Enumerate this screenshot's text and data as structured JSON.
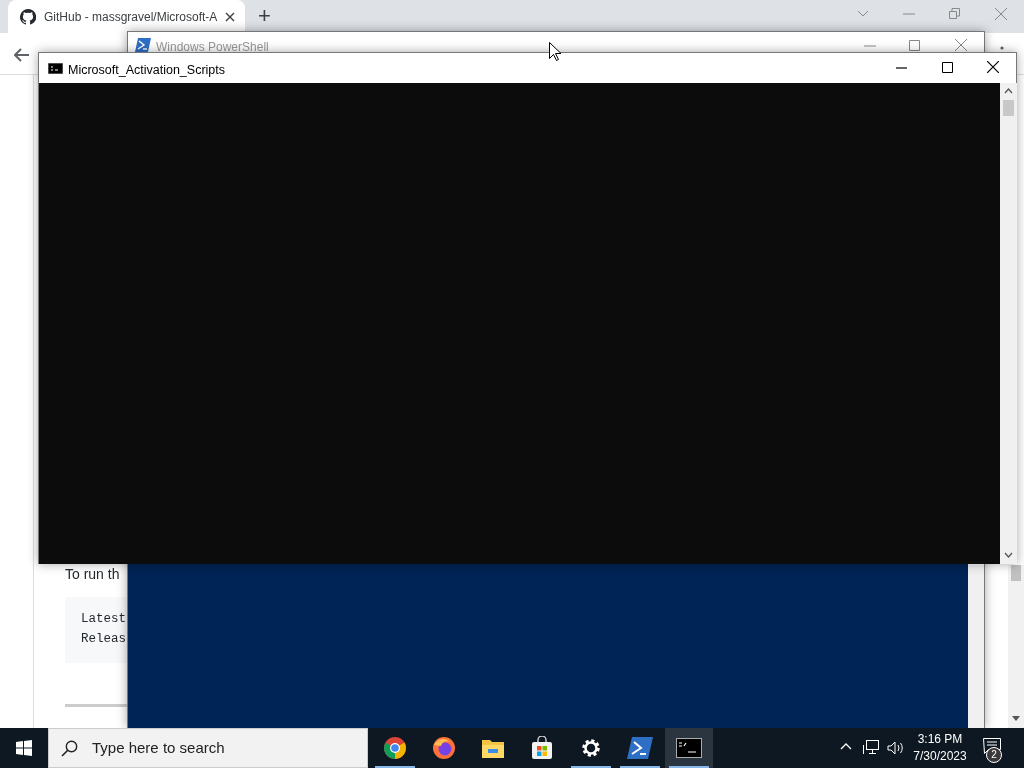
{
  "browser": {
    "tab": {
      "title": "GitHub - massgravel/Microsoft-A",
      "selected": true
    },
    "new_tab": "+",
    "page": {
      "intro": "To run th",
      "code_lines": [
        "Latest",
        "Releas"
      ]
    }
  },
  "powershell": {
    "title": "Windows PowerShell"
  },
  "console": {
    "title": "Microsoft_Activation_Scripts"
  },
  "taskbar": {
    "search": {
      "placeholder": "Type here to search"
    },
    "apps": [
      {
        "kind": "chrome",
        "running": true,
        "selected": false
      },
      {
        "kind": "firefox",
        "running": false,
        "selected": false
      },
      {
        "kind": "explorer",
        "running": false,
        "selected": false
      },
      {
        "kind": "store",
        "running": false,
        "selected": false
      },
      {
        "kind": "settings",
        "running": true,
        "selected": false
      },
      {
        "kind": "powershell",
        "running": true,
        "selected": false
      },
      {
        "kind": "console",
        "running": true,
        "selected": true
      }
    ],
    "clock": {
      "time": "3:16 PM",
      "date": "7/30/2023"
    },
    "notifications": {
      "count": "2"
    }
  }
}
